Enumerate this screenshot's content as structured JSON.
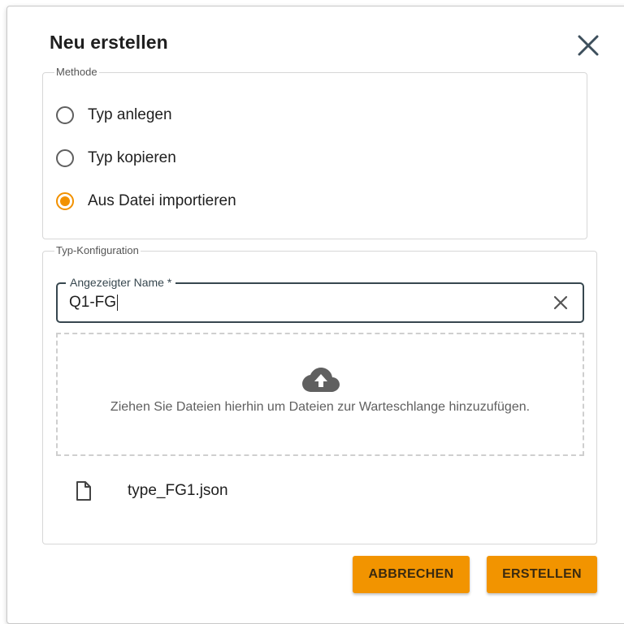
{
  "dialog": {
    "title": "Neu erstellen",
    "close_icon": "close-icon"
  },
  "methode": {
    "legend": "Methode",
    "options": [
      {
        "label": "Typ anlegen",
        "checked": false
      },
      {
        "label": "Typ kopieren",
        "checked": false
      },
      {
        "label": "Aus Datei importieren",
        "checked": true
      }
    ]
  },
  "config": {
    "legend": "Typ-Konfiguration",
    "name_field": {
      "label": "Angezeigter Name *",
      "value": "Q1-FG",
      "clear_icon": "clear-icon"
    },
    "dropzone": {
      "icon": "cloud-upload-icon",
      "text": "Ziehen Sie Dateien hierhin um Dateien zur Warteschlange hinzuzufügen."
    },
    "files": [
      {
        "name": "type_FG1.json",
        "icon": "file-icon"
      }
    ]
  },
  "actions": {
    "cancel_label": "ABBRECHEN",
    "create_label": "ERSTELLEN"
  },
  "colors": {
    "accent": "#f29400",
    "field_border": "#37474f"
  }
}
